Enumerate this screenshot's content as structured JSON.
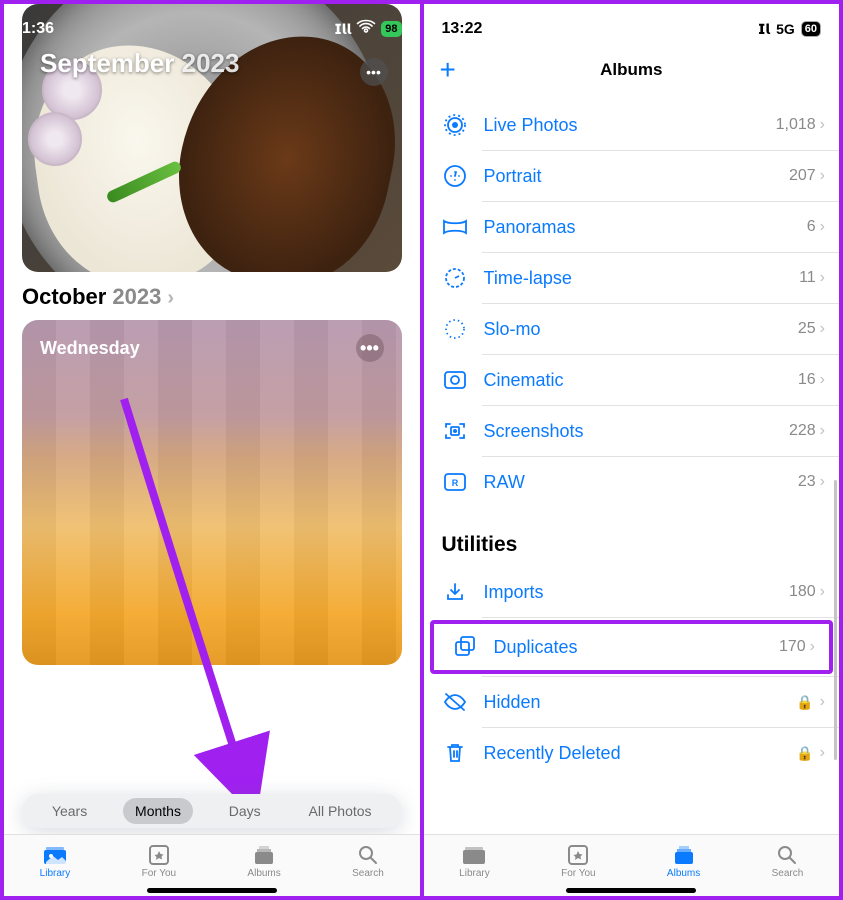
{
  "left": {
    "status": {
      "time": "1:36",
      "battery": "98"
    },
    "hero": {
      "month": "September",
      "year": "2023"
    },
    "month2": {
      "month": "October",
      "year": "2023"
    },
    "card2": {
      "day": "Wednesday"
    },
    "segments": {
      "years": "Years",
      "months": "Months",
      "days": "Days",
      "all": "All Photos"
    },
    "tabs": {
      "library": "Library",
      "foryou": "For You",
      "albums": "Albums",
      "search": "Search"
    }
  },
  "right": {
    "status": {
      "time": "13:22",
      "network": "5G",
      "battery": "60"
    },
    "nav": {
      "title": "Albums",
      "add": "+"
    },
    "media_types": [
      {
        "label": "Live Photos",
        "count": "1,018",
        "icon": "live"
      },
      {
        "label": "Portrait",
        "count": "207",
        "icon": "portrait"
      },
      {
        "label": "Panoramas",
        "count": "6",
        "icon": "pano"
      },
      {
        "label": "Time-lapse",
        "count": "11",
        "icon": "timelapse"
      },
      {
        "label": "Slo-mo",
        "count": "25",
        "icon": "slomo"
      },
      {
        "label": "Cinematic",
        "count": "16",
        "icon": "cinematic"
      },
      {
        "label": "Screenshots",
        "count": "228",
        "icon": "screenshot"
      },
      {
        "label": "RAW",
        "count": "23",
        "icon": "raw"
      }
    ],
    "utilities_title": "Utilities",
    "utilities": [
      {
        "label": "Imports",
        "count": "180",
        "icon": "import"
      },
      {
        "label": "Duplicates",
        "count": "170",
        "icon": "duplicates",
        "highlighted": true
      },
      {
        "label": "Hidden",
        "locked": true,
        "icon": "hidden"
      },
      {
        "label": "Recently Deleted",
        "locked": true,
        "icon": "trash"
      }
    ],
    "tabs": {
      "library": "Library",
      "foryou": "For You",
      "albums": "Albums",
      "search": "Search"
    }
  }
}
